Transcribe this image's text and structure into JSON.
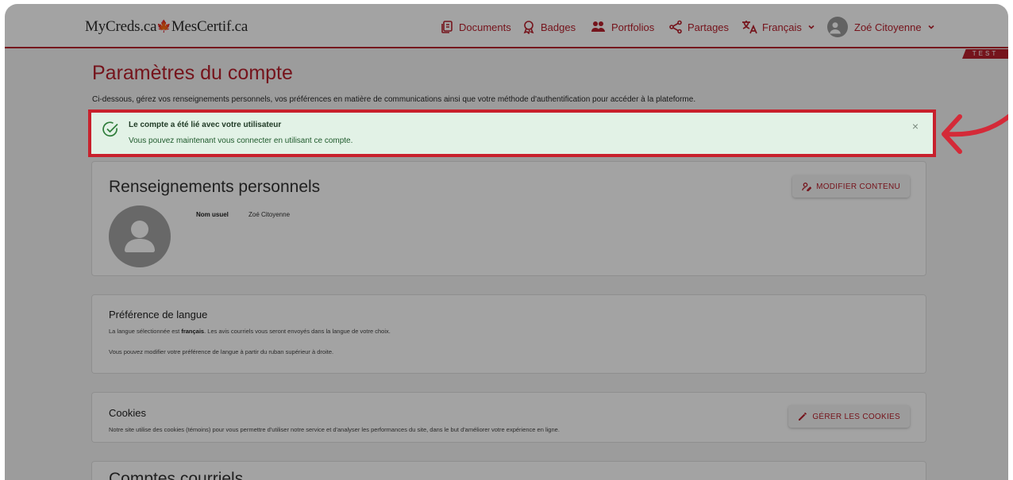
{
  "header": {
    "brand": "MyCreds.ca",
    "brand_leaf": "♣",
    "brand_suffix": "MesCertif.ca",
    "nav": {
      "documents": "Documents",
      "badges": "Badges",
      "portfolios": "Portfolios",
      "partages": "Partages",
      "language": "Français",
      "user": "Zoé Citoyenne"
    },
    "env_badge": "TEST"
  },
  "page": {
    "title": "Paramètres du compte",
    "description": "Ci-dessous, gérez vos renseignements personnels, vos préférences en matière de communications ainsi que votre méthode d'authentification pour accéder à la plateforme."
  },
  "alert": {
    "title": "Le compte a été lié avec votre utilisateur",
    "message": "Vous pouvez maintenant vous connecter en utilisant ce compte.",
    "close": "×"
  },
  "personal": {
    "title": "Renseignements personnels",
    "edit_button": "MODIFIER CONTENU",
    "name_label": "Nom usuel",
    "name_value": "Zoé Citoyenne"
  },
  "language_pref": {
    "title": "Préférence de langue",
    "line1_prefix": "La langue sélectionnée est ",
    "line1_lang": "français",
    "line1_suffix": ". Les avis courriels vous seront envoyés dans la langue de votre choix.",
    "line2": "Vous pouvez modifier votre préférence de langue à partir du ruban supérieur à droite."
  },
  "cookies": {
    "title": "Cookies",
    "text": "Notre site utilise des cookies (témoins) pour vous permettre d'utiliser notre service et d'analyser les performances du site, dans le but d'améliorer votre expérience en ligne.",
    "button": "GÉRER LES COOKIES"
  },
  "emails": {
    "title": "Comptes courriels"
  },
  "colors": {
    "accent": "#b8202c",
    "highlight": "#c8202c",
    "success_bg": "#e2f2e6"
  }
}
